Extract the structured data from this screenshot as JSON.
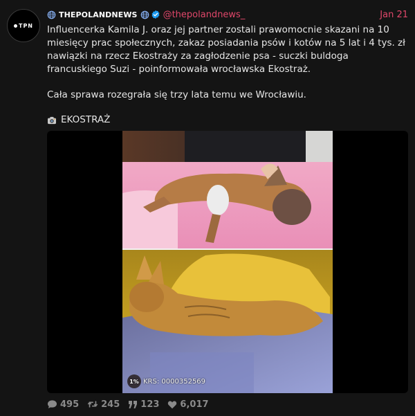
{
  "account": {
    "name": "THEPOLANDNEWS",
    "handle": "@thepolandnews_",
    "avatar_text": "TPN",
    "date": "Jan 21"
  },
  "tweet": {
    "paragraph1": "Influencerka Kamila J. oraz jej partner zostali prawomocnie skazani na 10 miesięcy prac społecznych, zakaz posiadania psów i kotów na 5 lat i 4 tys. zł nawiązki na rzecz Ekostraży za zagłodzenie psa - suczki buldoga francuskiego Suzi - poinformowała wrocławska Ekostraż.",
    "paragraph2": "Cała sprawa rozegrała się trzy lata temu we Wrocławiu.",
    "credit": "EKOSTRAŻ"
  },
  "media": {
    "badge": "1%",
    "watermark": "KRS: 0000352569"
  },
  "stats": {
    "replies": "495",
    "retweets": "245",
    "quotes": "123",
    "likes": "6,017"
  },
  "colors": {
    "background": "#141414",
    "accent": "#e0476a",
    "verified": "#1d9bf0",
    "muted": "#8a8a8a"
  },
  "icons": [
    "globe-icon",
    "verified-icon",
    "camera-icon",
    "reply-icon",
    "retweet-icon",
    "quote-icon",
    "like-icon"
  ]
}
